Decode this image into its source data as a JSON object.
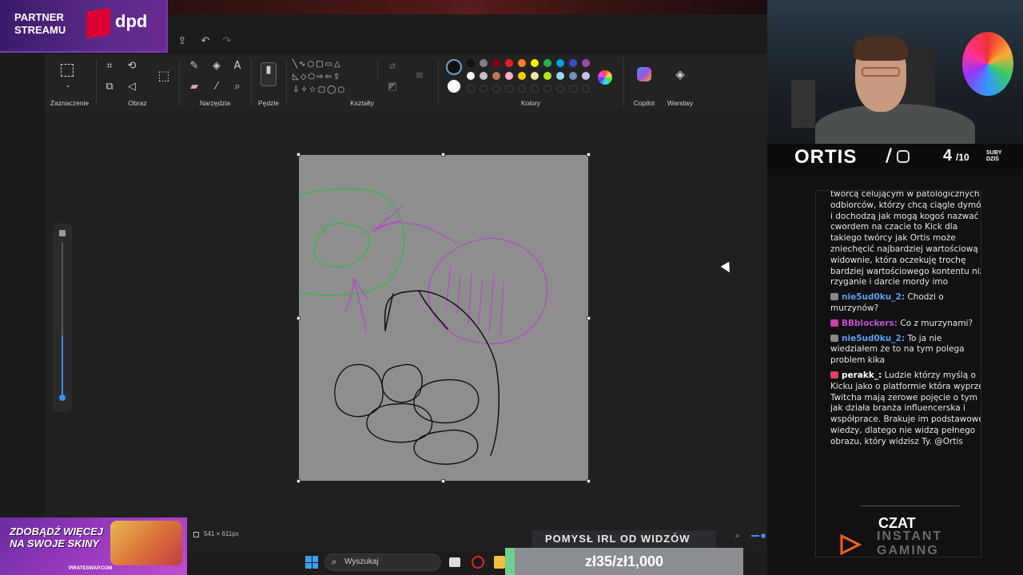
{
  "partner": {
    "line1": "PARTNER",
    "line2": "STREAMU",
    "brand": "dpd",
    "brand_color": "#dc0032"
  },
  "ribbon": {
    "groups": {
      "selection": "Zaznaczenie",
      "image": "Obraz",
      "tools": "Narzędzia",
      "brushes": "Pędzle",
      "shapes": "Kształty",
      "colors": "Kolory",
      "copilot": "Copilot",
      "layers": "Warstwy"
    },
    "tool_glyphs": {
      "text": "A"
    },
    "palette_row1": [
      "#101010",
      "#7f7f7f",
      "#880015",
      "#ed1c24",
      "#ff7f27",
      "#fff200",
      "#22b14c",
      "#00a2e8",
      "#3f48cc",
      "#a349a4"
    ],
    "palette_row2": [
      "#ffffff",
      "#c3c3c3",
      "#b97a57",
      "#ffaec9",
      "#ffc90e",
      "#efe4b0",
      "#b5e61d",
      "#99d9ea",
      "#7092be",
      "#c8bfe7"
    ]
  },
  "canvas": {
    "size_label": "541 × 611px",
    "background": "#8e8e8e"
  },
  "streamer": {
    "name": "ORTIS",
    "count": "4",
    "total": "/10",
    "subs_label1": "SUBY",
    "subs_label2": "DZIŚ"
  },
  "chat": {
    "messages": [
      {
        "user": "",
        "user_color": "#e6e6e6",
        "badge_color": "",
        "text": "twórcą celującym w patologicznych odbiorców, którzy chcą ciągle dymów i dochodzą jak mogą kogoś nazwać cwordem na czacie to Kick dla takiego twórcy jak Ortis może zniechęcić najbardziej wartościową widownie, która oczekuję trochę bardziej wartościowego kontentu niż rzyganie i darcie mordy imo"
      },
      {
        "user": "nie5ud0ku_2:",
        "user_color": "#5aa0e8",
        "badge_color": "#888888",
        "text": "Chodzi o murzynów?"
      },
      {
        "user": "BBblockers:",
        "user_color": "#c050d0",
        "badge_color": "#d040a0",
        "text": "Co z murzynami?"
      },
      {
        "user": "nie5ud0ku_2:",
        "user_color": "#5aa0e8",
        "badge_color": "#888888",
        "text": "To ja nie wiedziałem że to na tym polega problem kika"
      },
      {
        "user": "perakk_:",
        "user_color": "#ffffff",
        "badge_color": "#e04060",
        "text": "Ludzie którzy myślą o Kicku jako o platformie która wyprze Twitcha mają zerowe pojęcie o tym jak działa branża influencerska i współprace. Brakuje im podstawowej wiedzy, dlatego nie widzą pełnego obrazu, który widzisz Ty. @Ortis"
      }
    ],
    "footer_title": "CZAT",
    "footer_sub1": "INSTANT",
    "footer_sub2": "GAMING"
  },
  "promo": {
    "line1": "ZDOBĄDŹ WIĘCEJ",
    "line2": "NA SWOJE SKINY",
    "site": "PIRATESWAP.COM"
  },
  "taskbar": {
    "search_placeholder": "Wyszukaj"
  },
  "irl": {
    "label": "POMYSŁ IRL OD WIDZÓW"
  },
  "money": {
    "label": "zł35/zł1,000",
    "progress": 0.035,
    "accent": "#6fd08f"
  }
}
